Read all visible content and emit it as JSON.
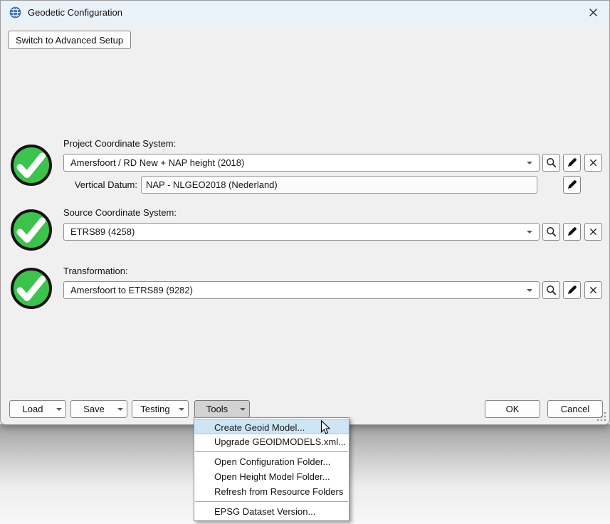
{
  "window": {
    "title": "Geodetic Configuration"
  },
  "setup": {
    "switch_button": "Switch to Advanced Setup"
  },
  "sections": {
    "project": {
      "label": "Project Coordinate System:",
      "value": "Amersfoort / RD New + NAP height (2018)",
      "status": "valid"
    },
    "vertical_datum": {
      "label": "Vertical Datum:",
      "value": "NAP - NLGEO2018 (Nederland)"
    },
    "source": {
      "label": "Source Coordinate System:",
      "value": "ETRS89 (4258)",
      "status": "valid"
    },
    "transformation": {
      "label": "Transformation:",
      "value": "Amersfoort to ETRS89 (9282)",
      "status": "valid"
    }
  },
  "footer": {
    "load": "Load",
    "save": "Save",
    "testing": "Testing",
    "tools": "Tools",
    "ok": "OK",
    "cancel": "Cancel"
  },
  "tools_menu": {
    "items": [
      {
        "label": "Create Geoid Model...",
        "highlighted": true
      },
      {
        "label": "Upgrade GEOIDMODELS.xml...",
        "highlighted": false
      },
      {
        "label": "Open Configuration Folder...",
        "highlighted": false
      },
      {
        "label": "Open Height Model Folder...",
        "highlighted": false
      },
      {
        "label": "Refresh from Resource Folders",
        "highlighted": false
      },
      {
        "label": "EPSG Dataset Version...",
        "highlighted": false
      }
    ]
  },
  "icons": {
    "titlebar": "globe-icon",
    "status": "check-circle-icon",
    "combo_actions": [
      "search-icon",
      "edit-pen-icon",
      "clear-x-icon"
    ],
    "menu_cursor": "arrow-cursor"
  },
  "colors": {
    "titlebar_bg": "#e9f1f9",
    "dialog_bg": "#f0f0f0",
    "status_green": "#3ec24e",
    "menu_highlight": "#cde5f5",
    "globe_blue": "#3a70b8"
  }
}
